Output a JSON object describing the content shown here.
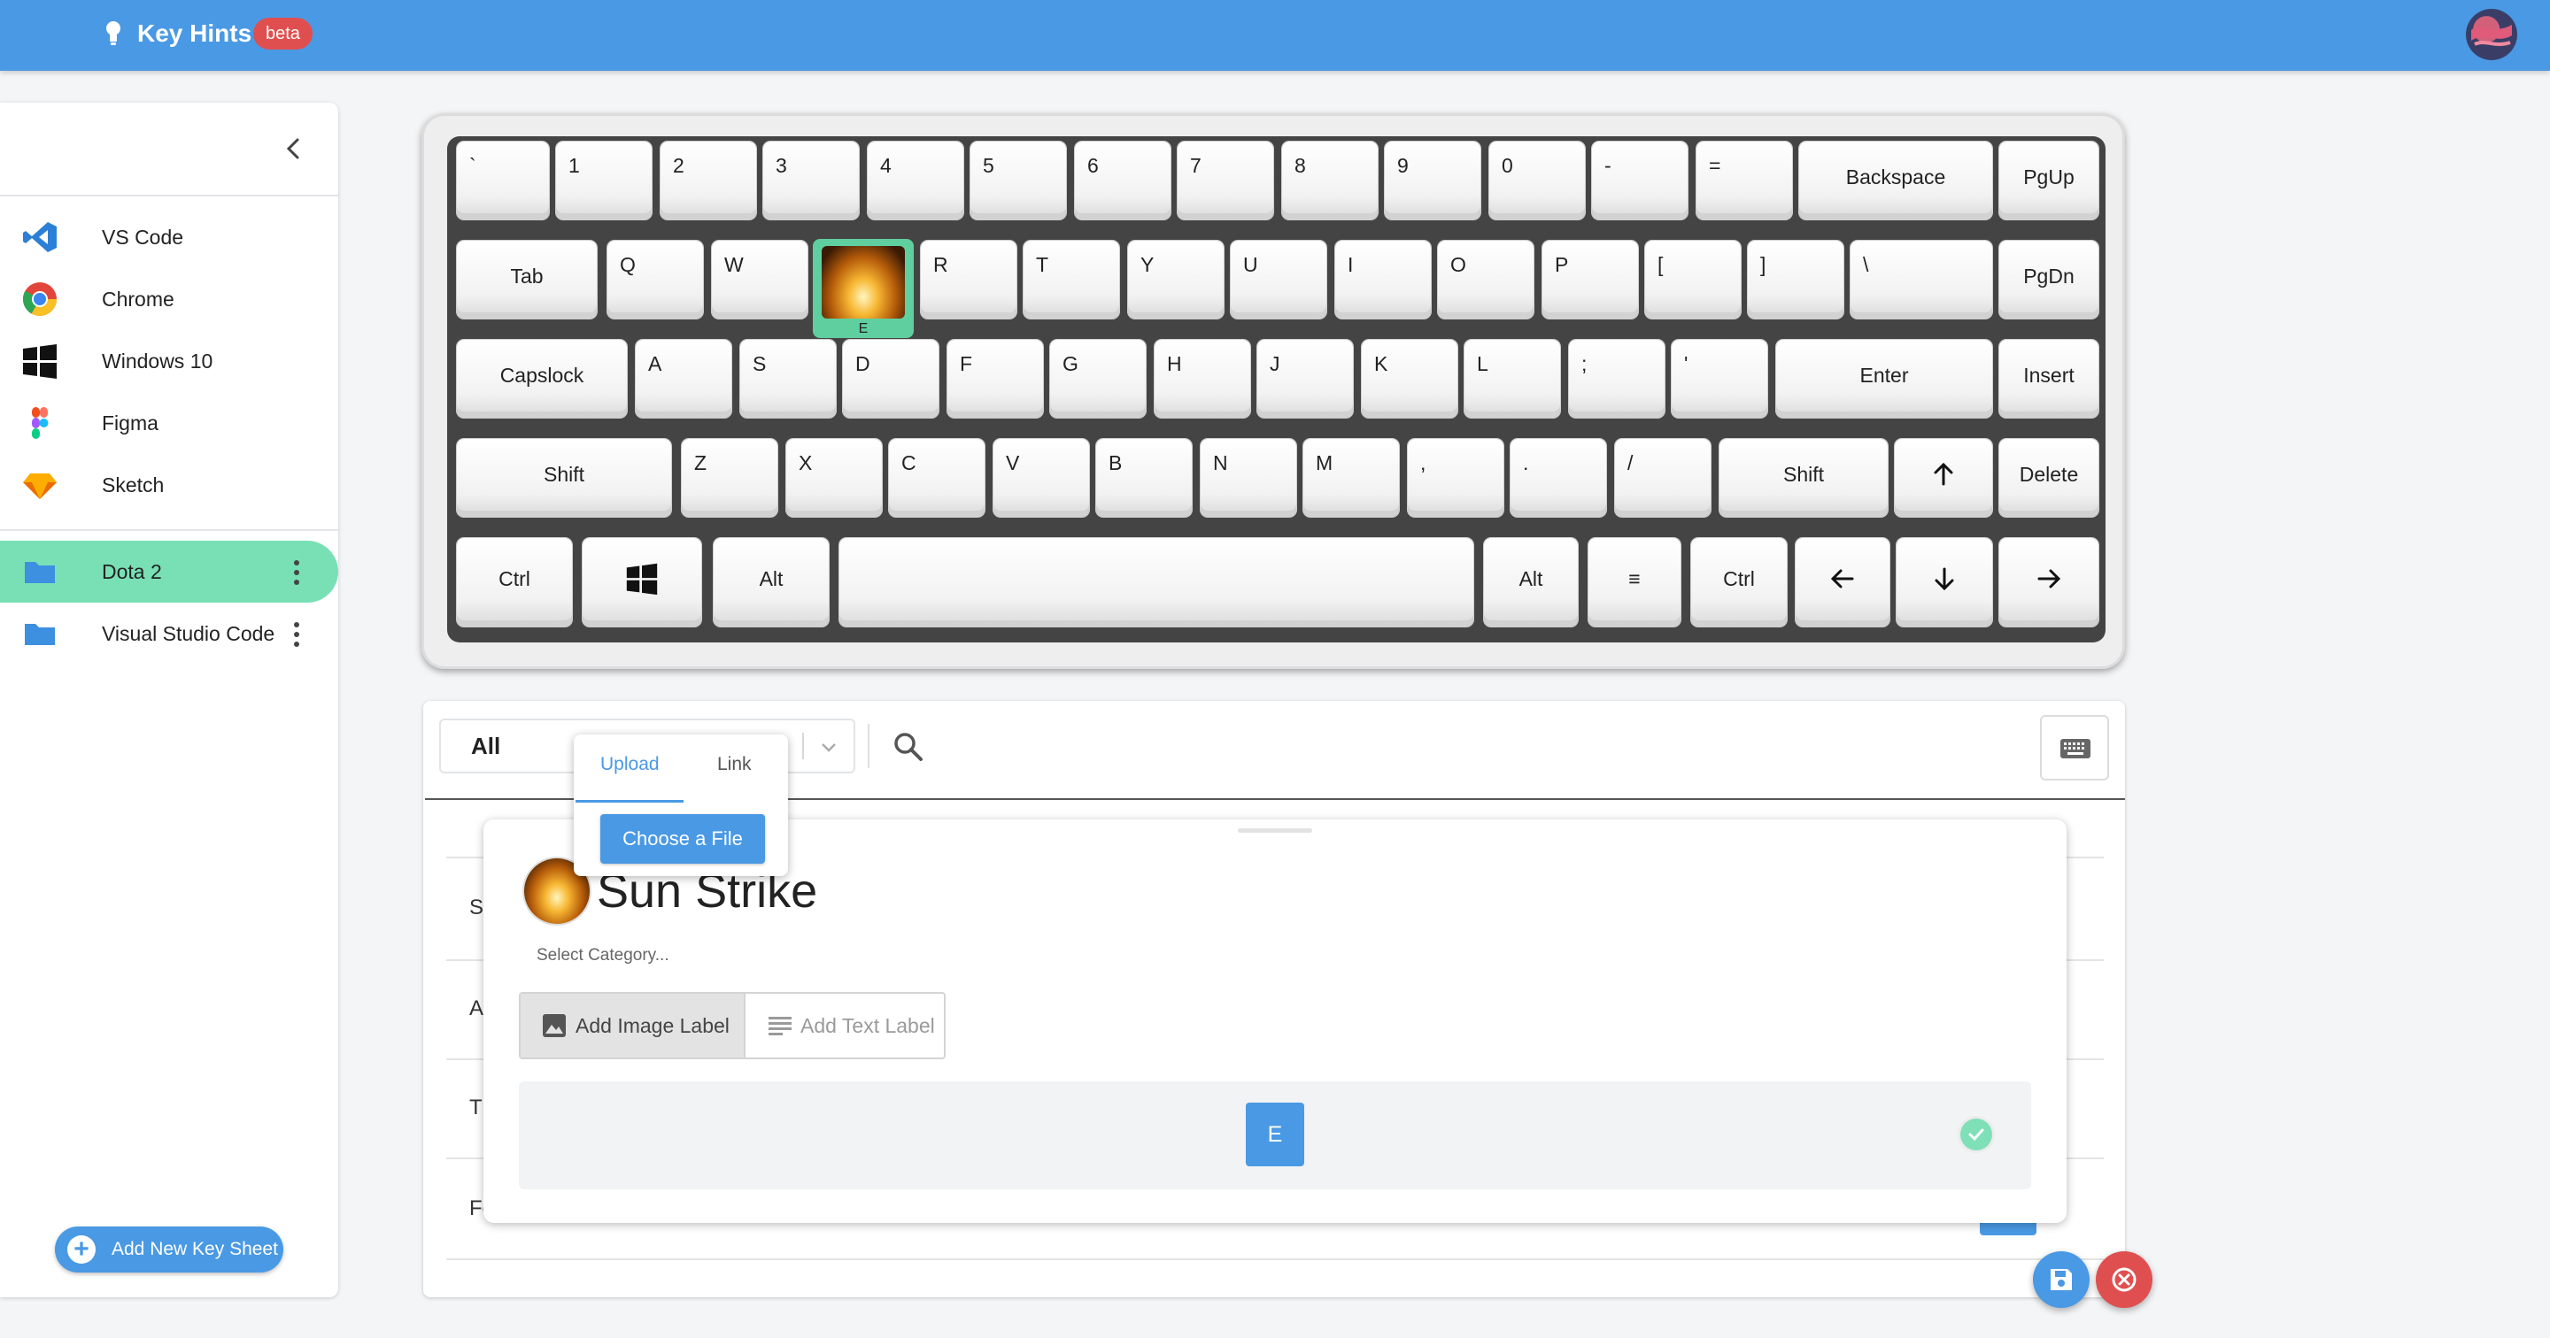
{
  "app": {
    "title": "Key Hints",
    "badge": "beta"
  },
  "sidebar": {
    "apps": [
      {
        "label": "VS Code",
        "icon": "vscode-icon"
      },
      {
        "label": "Chrome",
        "icon": "chrome-icon"
      },
      {
        "label": "Windows 10",
        "icon": "windows-icon"
      },
      {
        "label": "Figma",
        "icon": "figma-icon"
      },
      {
        "label": "Sketch",
        "icon": "sketch-icon"
      }
    ],
    "sheets": [
      {
        "label": "Dota 2",
        "icon": "folder-icon",
        "active": true
      },
      {
        "label": "Visual Studio Code",
        "icon": "folder-icon",
        "active": false
      }
    ],
    "add_button": "Add New Key Sheet"
  },
  "keyboard": {
    "rows": [
      [
        "`",
        "1",
        "2",
        "3",
        "4",
        "5",
        "6",
        "7",
        "8",
        "9",
        "0",
        "-",
        "=",
        "Backspace",
        "PgUp"
      ],
      [
        "Tab",
        "Q",
        "W",
        "",
        "R",
        "T",
        "Y",
        "U",
        "I",
        "O",
        "P",
        "[",
        "]",
        "\\",
        "PgDn"
      ],
      [
        "Capslock",
        "A",
        "S",
        "D",
        "F",
        "G",
        "H",
        "J",
        "K",
        "L",
        ";",
        "'",
        "Enter",
        "Insert"
      ],
      [
        "Shift",
        "Z",
        "X",
        "C",
        "V",
        "B",
        "N",
        "M",
        ",",
        ".",
        "/",
        "Shift",
        "",
        "Delete"
      ],
      [
        "Ctrl",
        "",
        "Alt",
        "",
        "Alt",
        "≡",
        "Ctrl",
        "",
        "",
        ""
      ]
    ],
    "highlighted_key": {
      "sublabel": "E"
    }
  },
  "panel": {
    "category_value": "All",
    "row_stubs": [
      "S",
      "A",
      "T",
      "Fo"
    ]
  },
  "editor": {
    "hint_name": "Sun Strike",
    "category_placeholder": "Select Category...",
    "image_label_button": "Add Image Label",
    "text_label_button": "Add Text Label",
    "bound_key": "E"
  },
  "upload_popover": {
    "tab_upload": "Upload",
    "tab_link": "Link",
    "choose_button": "Choose a File"
  },
  "colors": {
    "primary": "#4a99e4",
    "accent_green": "#79e0b6",
    "danger": "#e04f4f",
    "badge": "#e04f4f"
  }
}
